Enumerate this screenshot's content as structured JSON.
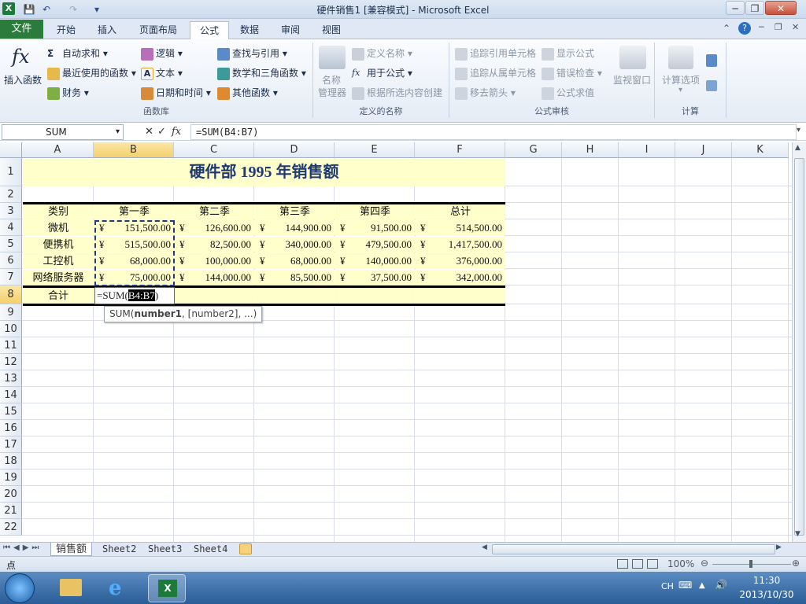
{
  "window": {
    "title": "硬件销售1  [兼容模式] - Microsoft Excel",
    "app_icon": "X"
  },
  "qat": {
    "save": "💾",
    "undo": "↶",
    "redo": "↷",
    "customize": "▾"
  },
  "win_controls": {
    "minimize": "─",
    "restore": "❐",
    "close": "✕"
  },
  "tabs": {
    "file": "文件",
    "items": [
      "开始",
      "插入",
      "页面布局",
      "公式",
      "数据",
      "审阅",
      "视图"
    ]
  },
  "ribbon": {
    "insert_function": "插入函数",
    "function_library": {
      "label": "函数库",
      "autosum": "自动求和 ▾",
      "recent": "最近使用的函数 ▾",
      "finance": "财务 ▾",
      "logic": "逻辑 ▾",
      "text": "文本 ▾",
      "datetime": "日期和时间 ▾",
      "lookup": "查找与引用 ▾",
      "math": "数学和三角函数 ▾",
      "other": "其他函数 ▾"
    },
    "defined_names": {
      "label": "定义的名称",
      "manager_line1": "名称",
      "manager_line2": "管理器",
      "define": "定义名称 ▾",
      "use_in_formula": "用于公式 ▾",
      "create_from_sel": "根据所选内容创建"
    },
    "auditing": {
      "label": "公式审核",
      "trace_precedents": "追踪引用单元格",
      "trace_dependents": "追踪从属单元格",
      "remove_arrows": "移去箭头 ▾",
      "show_formulas": "显示公式",
      "error_check": "错误检查 ▾",
      "evaluate": "公式求值",
      "watch": "监视窗口"
    },
    "calculation": {
      "label": "计算",
      "options": "计算选项",
      "options_arrow": "▾"
    }
  },
  "formula_bar": {
    "name_box": "SUM",
    "cancel": "✕",
    "enter": "✓",
    "fx": "fx",
    "formula": "=SUM(B4:B7)"
  },
  "columns": [
    "A",
    "B",
    "C",
    "D",
    "E",
    "F",
    "G",
    "H",
    "I",
    "J",
    "K"
  ],
  "rows": [
    "1",
    "2",
    "3",
    "4",
    "5",
    "6",
    "7",
    "8",
    "9",
    "10",
    "11",
    "12",
    "13",
    "14",
    "15",
    "16",
    "17",
    "18",
    "19",
    "20",
    "21",
    "22"
  ],
  "sheet": {
    "title": "硬件部 1995 年销售额",
    "headers": [
      "类别",
      "第一季",
      "第二季",
      "第三季",
      "第四季",
      "总计"
    ],
    "currency": "¥",
    "data": [
      {
        "cat": "微机",
        "vals": [
          "151,500.00",
          "126,600.00",
          "144,900.00",
          "91,500.00",
          "514,500.00"
        ]
      },
      {
        "cat": "便携机",
        "vals": [
          "515,500.00",
          "82,500.00",
          "340,000.00",
          "479,500.00",
          "1,417,500.00"
        ]
      },
      {
        "cat": "工控机",
        "vals": [
          "68,000.00",
          "100,000.00",
          "68,000.00",
          "140,000.00",
          "376,000.00"
        ]
      },
      {
        "cat": "网络服务器",
        "vals": [
          "75,000.00",
          "144,000.00",
          "85,500.00",
          "37,500.00",
          "342,000.00"
        ]
      }
    ],
    "total_label": "合计",
    "editing_prefix": "=SUM(",
    "editing_ref": "B4:B7",
    "editing_suffix": ")",
    "tooltip_prefix": "SUM(",
    "tooltip_arg1": "number1",
    "tooltip_rest": ", [number2], ...)"
  },
  "sheet_tabs": [
    "销售额",
    "Sheet2",
    "Sheet3",
    "Sheet4"
  ],
  "status": {
    "mode": "点",
    "zoom": "100%"
  },
  "taskbar": {
    "lang": "CH",
    "time": "11:30",
    "date": "2013/10/30"
  }
}
